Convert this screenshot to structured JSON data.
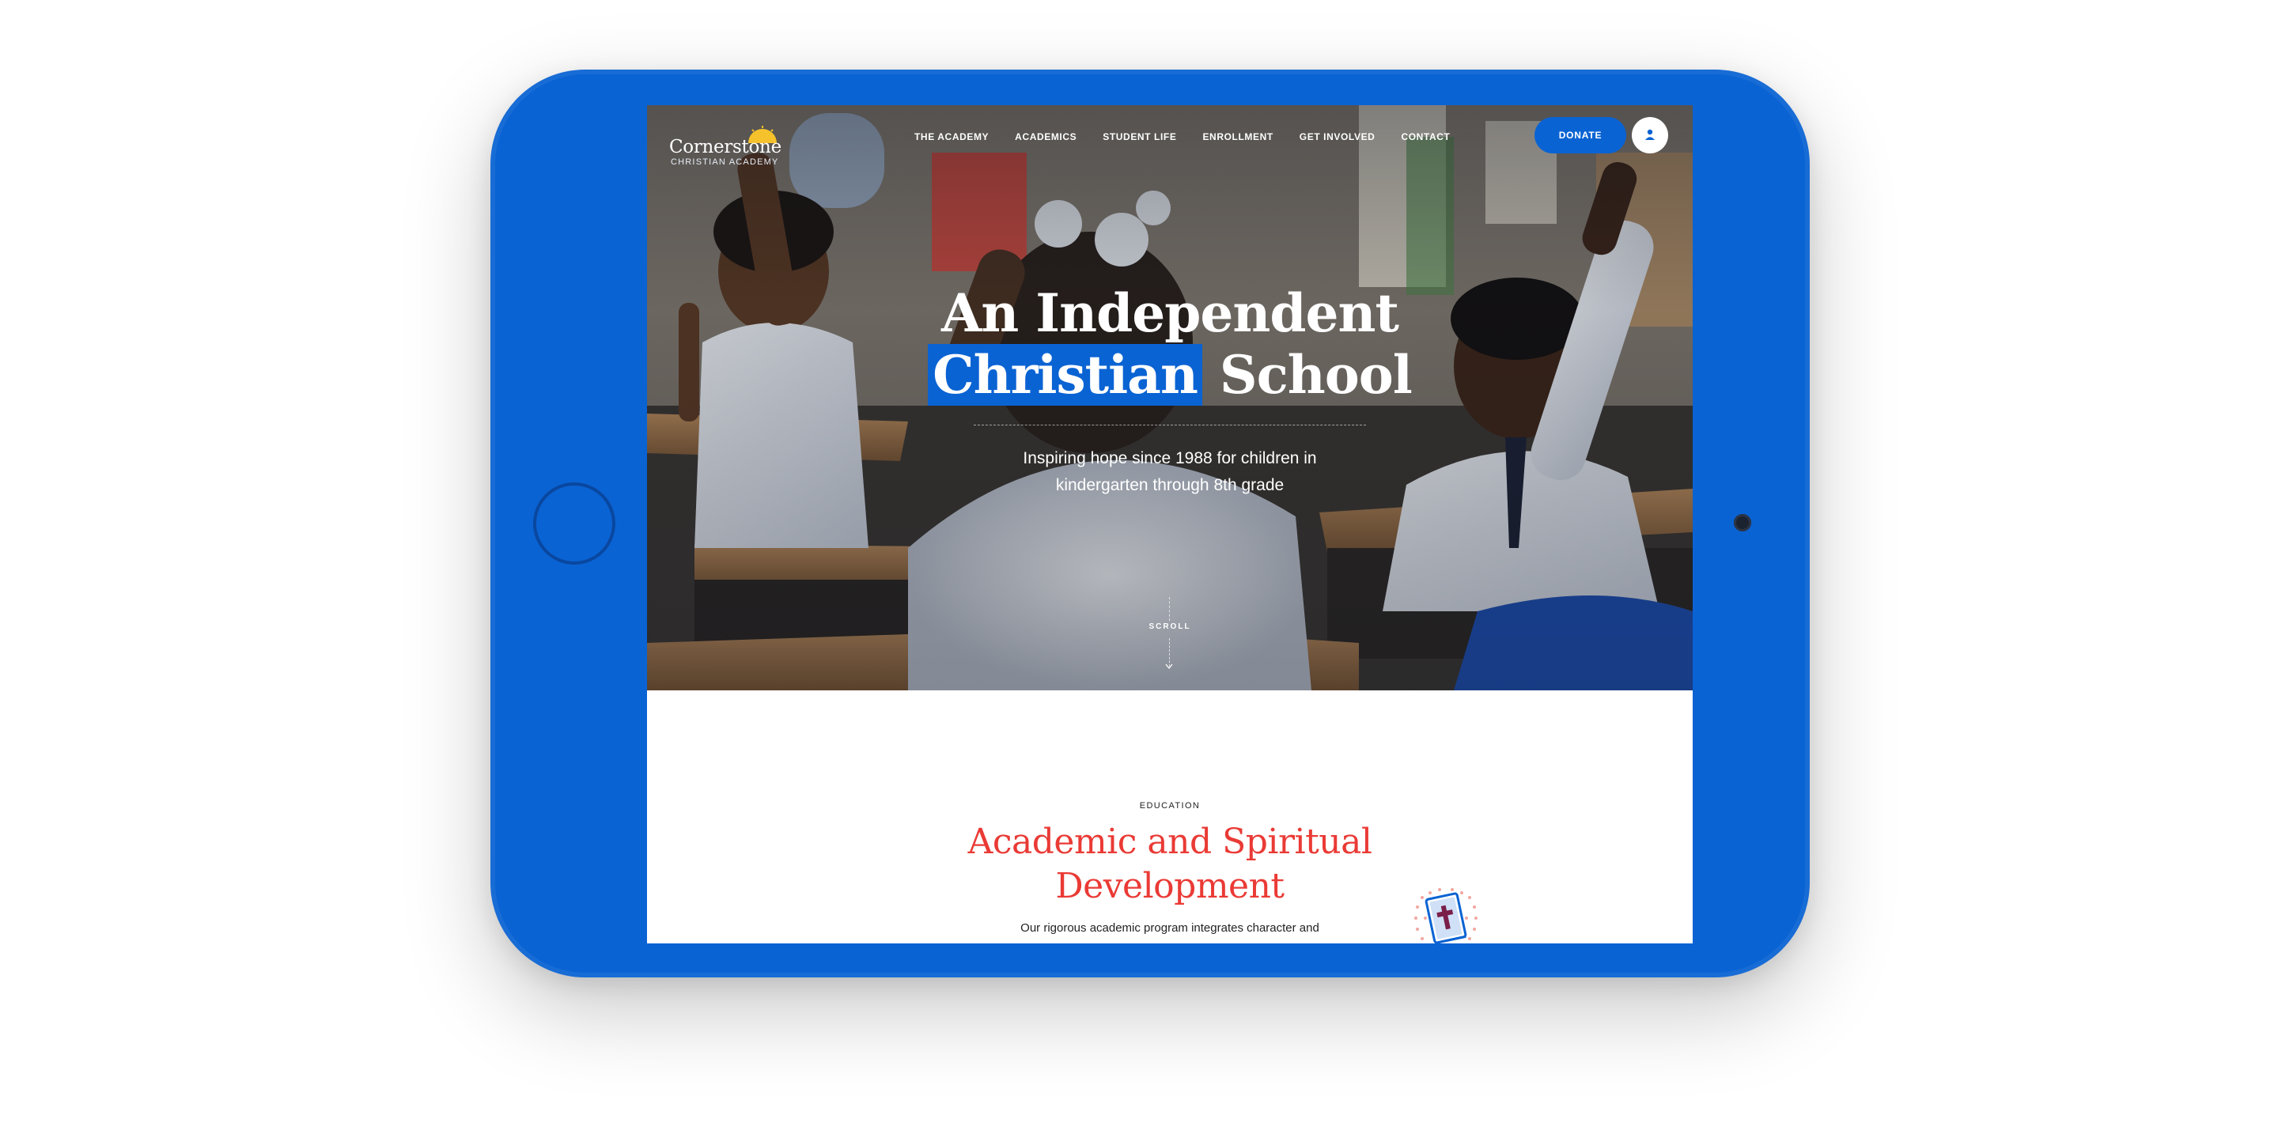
{
  "nav": {
    "logo_name": "Cornerstone",
    "logo_sub": "CHRISTIAN ACADEMY",
    "items": [
      {
        "label": "THE ACADEMY"
      },
      {
        "label": "ACADEMICS"
      },
      {
        "label": "STUDENT LIFE"
      },
      {
        "label": "ENROLLMENT"
      },
      {
        "label": "GET INVOLVED"
      },
      {
        "label": "CONTACT"
      }
    ],
    "donate_label": "DONATE",
    "account_icon": "user-icon"
  },
  "hero": {
    "title_line1": "An Independent",
    "title_highlight": "Christian",
    "title_rest": " School",
    "subtitle": "Inspiring hope since 1988 for children in kindergarten through 8th grade",
    "scroll_label": "SCROLL"
  },
  "education": {
    "eyebrow": "EDUCATION",
    "title": "Academic and Spiritual Development",
    "body": "Our rigorous academic program integrates character and",
    "icon": "bible-icon"
  },
  "colors": {
    "brand_blue": "#0a63d3",
    "accent_red": "#ea3a35",
    "sun_yellow": "#f5c22c"
  }
}
